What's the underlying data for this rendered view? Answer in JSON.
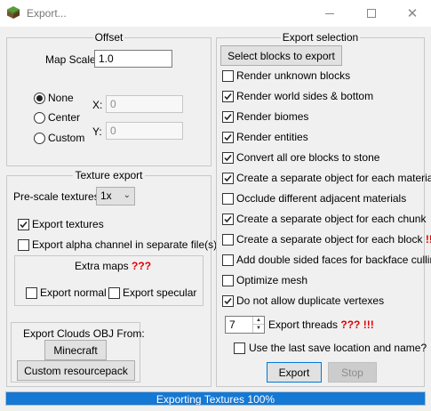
{
  "window": {
    "title": "Export...",
    "icons": {
      "app": "grass-block-icon",
      "minimize": "minimize-icon",
      "maximize": "maximize-icon",
      "close": "close-icon"
    }
  },
  "offset": {
    "title": "Offset",
    "map_scale_label": "Map Scale:",
    "map_scale_value": "1.0",
    "options": [
      {
        "label": "None",
        "checked": true
      },
      {
        "label": "Center",
        "checked": false
      },
      {
        "label": "Custom",
        "checked": false
      }
    ],
    "x_label": "X:",
    "x_value": "0",
    "y_label": "Y:",
    "y_value": "0"
  },
  "texture": {
    "title": "Texture export",
    "prescale_label": "Pre-scale textures:",
    "prescale_value": "1x",
    "export_textures_label": "Export textures",
    "export_textures_checked": true,
    "export_alpha_label": "Export alpha channel in separate file(s)",
    "export_alpha_checked": false,
    "extra_maps_title": "Extra maps",
    "extra_maps_marker": "???",
    "export_normal_label": "Export normal",
    "export_normal_checked": false,
    "export_specular_label": "Export specular",
    "export_specular_checked": false
  },
  "clouds": {
    "title": "Export Clouds OBJ From:",
    "minecraft_button": "Minecraft",
    "resourcepack_button": "Custom resourcepack"
  },
  "selection": {
    "title": "Export selection",
    "select_blocks_button": "Select blocks to export",
    "options": [
      {
        "label": "Render unknown blocks",
        "checked": false,
        "marker": ""
      },
      {
        "label": "Render world sides & bottom",
        "checked": true,
        "marker": ""
      },
      {
        "label": "Render biomes",
        "checked": true,
        "marker": ""
      },
      {
        "label": "Render entities",
        "checked": true,
        "marker": ""
      },
      {
        "label": "Convert all ore blocks to stone",
        "checked": true,
        "marker": ""
      },
      {
        "label": "Create a separate object for each material",
        "checked": true,
        "marker": ""
      },
      {
        "label": "Occlude different adjacent materials",
        "checked": false,
        "marker": ""
      },
      {
        "label": "Create a separate object for each chunk",
        "checked": true,
        "marker": ""
      },
      {
        "label": "Create a separate object for each block",
        "checked": false,
        "marker": "!!!"
      },
      {
        "label": "Add double sided faces for backface culling",
        "checked": false,
        "marker": ""
      },
      {
        "label": "Optimize mesh",
        "checked": false,
        "marker": ""
      },
      {
        "label": "Do not allow duplicate vertexes",
        "checked": true,
        "marker": ""
      }
    ],
    "threads_value": "7",
    "threads_label": "Export threads",
    "threads_marker_1": "???",
    "threads_marker_2": "!!!",
    "last_save_label": "Use the last save location and name?",
    "last_save_checked": false,
    "export_button": "Export",
    "stop_button": "Stop"
  },
  "progress": {
    "text": "Exporting Textures 100%",
    "percent": 100
  },
  "colors": {
    "accent": "#1478d4",
    "warning_marker": "#e00000"
  }
}
